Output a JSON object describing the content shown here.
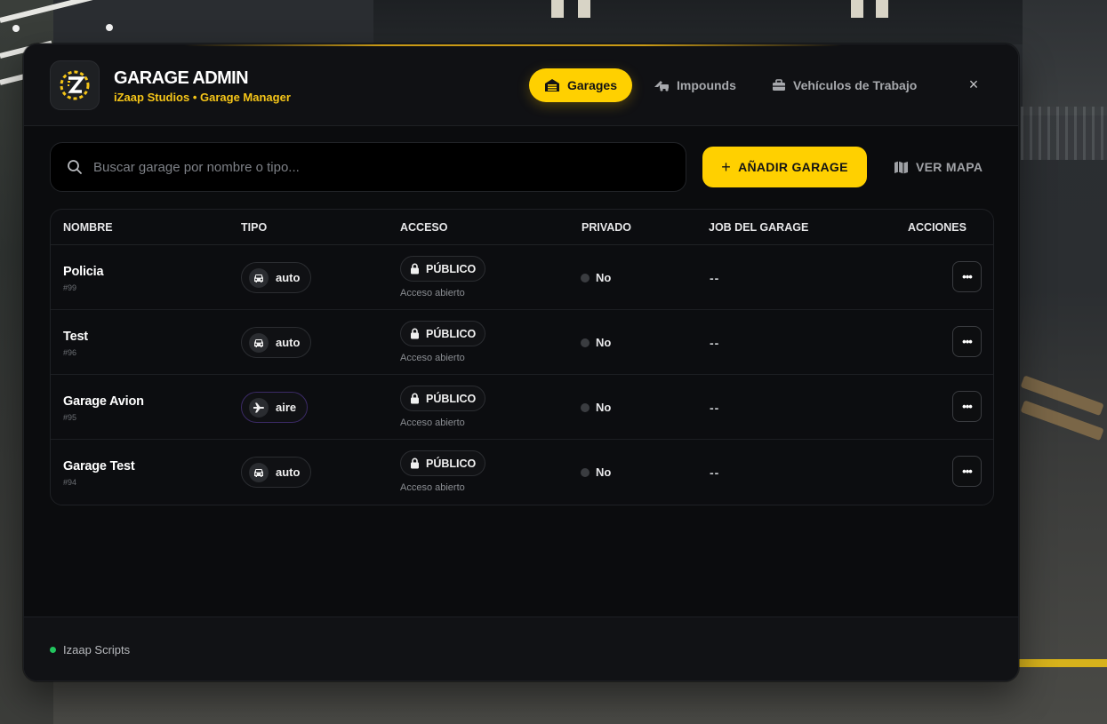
{
  "app": {
    "title": "GARAGE ADMIN",
    "subtitle": "iZaap Studios • Garage Manager"
  },
  "tabs": [
    {
      "label": "Garages",
      "icon": "garage-icon",
      "active": true
    },
    {
      "label": "Impounds",
      "icon": "tow-truck-icon",
      "active": false
    },
    {
      "label": "Vehículos de Trabajo",
      "icon": "briefcase-icon",
      "active": false
    }
  ],
  "close_label": "×",
  "search": {
    "placeholder": "Buscar garage por nombre o tipo...",
    "value": ""
  },
  "toolbar": {
    "add_label": "AÑADIR GARAGE",
    "add_icon": "+",
    "map_label": "VER MAPA"
  },
  "table": {
    "headers": [
      "NOMBRE",
      "TIPO",
      "ACCESO",
      "PRIVADO",
      "JOB DEL GARAGE",
      "ACCIONES"
    ],
    "rows": [
      {
        "name": "Policia",
        "id": "#99",
        "tipo": "auto",
        "tipo_icon": "car-icon",
        "acceso": "PÚBLICO",
        "acceso_sub": "Acceso abierto",
        "privado": "No",
        "job": "--",
        "actions": "•••"
      },
      {
        "name": "Test",
        "id": "#96",
        "tipo": "auto",
        "tipo_icon": "car-icon",
        "acceso": "PÚBLICO",
        "acceso_sub": "Acceso abierto",
        "privado": "No",
        "job": "--",
        "actions": "•••"
      },
      {
        "name": "Garage Avion",
        "id": "#95",
        "tipo": "aire",
        "tipo_icon": "plane-icon",
        "acceso": "PÚBLICO",
        "acceso_sub": "Acceso abierto",
        "privado": "No",
        "job": "--",
        "actions": "•••"
      },
      {
        "name": "Garage Test",
        "id": "#94",
        "tipo": "auto",
        "tipo_icon": "car-icon",
        "acceso": "PÚBLICO",
        "acceso_sub": "Acceso abierto",
        "privado": "No",
        "job": "--",
        "actions": "•••"
      }
    ]
  },
  "footer": {
    "label": "Izaap Scripts",
    "status_color": "#22c55e"
  },
  "colors": {
    "accent": "#ffd000",
    "panel": "#0b0c0e",
    "subtitle": "#f5c518"
  }
}
